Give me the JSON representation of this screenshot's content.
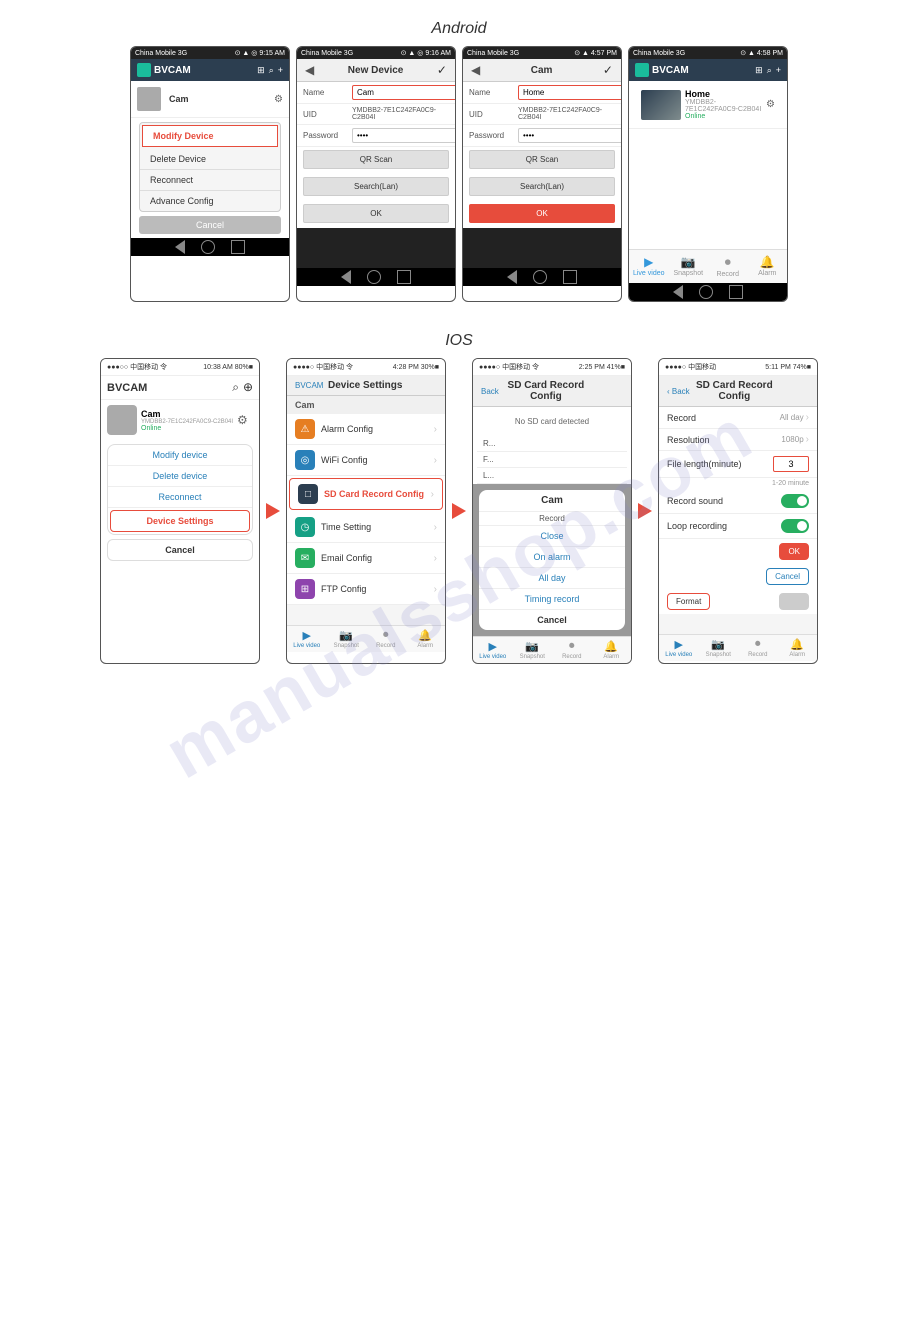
{
  "watermark": "manualsshop.com",
  "android_label": "Android",
  "ios_label": "IOS",
  "android_phones": {
    "phone1": {
      "status_bar": "China Mobile 3G",
      "status_icons": "⊙ ▲ ◎ 9:15 AM",
      "app_name": "BVCAM",
      "cam_name": "Cam",
      "cam_name2": "Cam",
      "menu_items": [
        "Modify Device",
        "Delete Device",
        "Reconnect",
        "Advance Config"
      ],
      "selected_item": "Modify Device",
      "cancel": "Cancel"
    },
    "phone2": {
      "status_bar": "China Mobile 3G",
      "status_icons": "⊙ ▲ ◎ 9:16 AM",
      "title": "New Device",
      "name_label": "Name",
      "name_value": "Cam",
      "uid_label": "UID",
      "uid_value": "YMDBB2-7E1C242FA0C9-C2B04I",
      "password_label": "Password",
      "password_value": "••••",
      "qr_scan": "QR Scan",
      "search_lan": "Search(Lan)",
      "ok": "OK"
    },
    "phone3": {
      "status_bar": "China Mobile 3G",
      "status_icons": "⊙ ▲ 4:57 PM",
      "title": "Cam",
      "name_label": "Name",
      "name_value": "Home",
      "uid_label": "UID",
      "uid_value": "YMDBB2-7E1C242FA0C9-C2B04I",
      "password_label": "Password",
      "password_value": "••••",
      "qr_scan": "QR Scan",
      "search_lan": "Search(Lan)",
      "ok": "OK"
    },
    "phone4": {
      "status_bar": "China Mobile 3G",
      "status_icons": "⊙ ▲ 4:58 PM",
      "app_name": "BVCAM",
      "cam_name": "Home",
      "cam_uid": "YMDBB2-7E1C242FA0C9-C2B04I",
      "cam_status": "Online",
      "tab_labels": [
        "Live video",
        "Snapshot",
        "Record",
        "Alarm"
      ]
    }
  },
  "ios_phones": {
    "phone1": {
      "status_bar": "●●●○○ 中国移动 令",
      "status_right": "10:38 AM   80%■",
      "app_name": "BVCAM",
      "cam_name": "Cam",
      "cam_uid": "YMDBB2-7E1C242FA0C9-C2B04I",
      "cam_status": "Online",
      "menu_items": [
        "Modify device",
        "Delete device",
        "Reconnect",
        "Device Settings"
      ],
      "selected_item": "Device Settings",
      "cancel": "Cancel",
      "tab_labels": []
    },
    "phone2": {
      "status_bar": "●●●●○ 中国移动 令",
      "status_right": "4:28 PM   30%■",
      "back_label": "BVCAM",
      "title": "Device Settings",
      "section_title": "Cam",
      "settings_items": [
        {
          "icon": "⚠",
          "icon_color": "icon-orange",
          "label": "Alarm Config"
        },
        {
          "icon": "◎",
          "icon_color": "icon-blue",
          "label": "WiFi Config"
        },
        {
          "icon": "□",
          "icon_color": "icon-navy",
          "label": "SD Card Record Config"
        },
        {
          "icon": "◷",
          "icon_color": "icon-teal",
          "label": "Time Setting"
        },
        {
          "icon": "✉",
          "icon_color": "icon-green",
          "label": "Email Config"
        },
        {
          "icon": "⊞",
          "icon_color": "icon-purple",
          "label": "FTP Config"
        }
      ],
      "highlighted_item": "SD Card Record Config",
      "tab_labels": [
        "Live video",
        "Snapshot",
        "Record",
        "Alarm"
      ]
    },
    "phone3": {
      "status_bar": "●●●●○ 中国移动 令",
      "status_right": "2:25 PM   41%■",
      "back_label": "Back",
      "title": "SD Card Record Config",
      "no_sd": "No SD card detected",
      "modal_title": "Cam",
      "modal_subtitle": "Record",
      "modal_options": [
        "Close",
        "On alarm",
        "All day",
        "Timing record"
      ],
      "modal_cancel": "Cancel",
      "tab_labels": [
        "Live video",
        "Snapshot",
        "Record",
        "Alarm"
      ]
    },
    "phone4": {
      "status_bar": "●●●●○ 中国移动",
      "status_right": "5:11 PM   74%■",
      "back_label": "Back",
      "title": "SD Card Record Config",
      "record_label": "Record",
      "record_value": "All day",
      "resolution_label": "Resolution",
      "resolution_value": "1080p",
      "file_length_label": "File length(minute)",
      "file_length_value": "3",
      "file_length_note": "1-20 minute",
      "record_sound_label": "Record sound",
      "loop_recording_label": "Loop recording",
      "ok_btn": "OK",
      "cancel_btn": "Cancel",
      "format_btn": "Format",
      "tab_labels": [
        "Live video",
        "Snapshot",
        "Record",
        "Alarm"
      ]
    }
  }
}
